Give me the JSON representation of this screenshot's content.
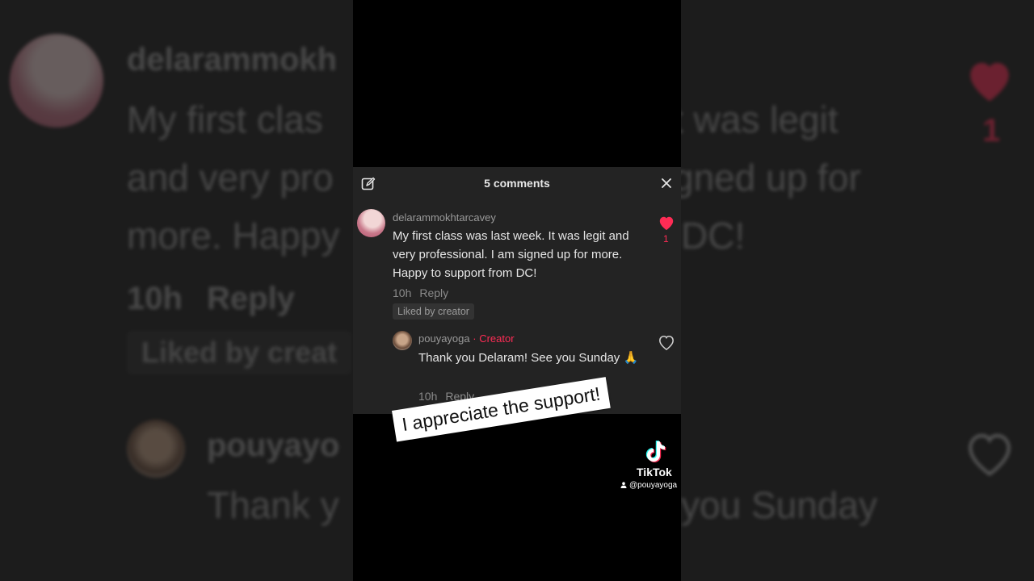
{
  "panel": {
    "title": "5 comments"
  },
  "comment1": {
    "username": "delarammokhtarcavey",
    "text": "My first class was last week. It was legit and very professional. I am signed up for more. Happy to support from DC!",
    "time": "10h",
    "reply_label": "Reply",
    "liked_chip": "Liked by creator",
    "like_count": "1",
    "liked": true
  },
  "reply1": {
    "username": "pouyayoga",
    "separator": "·",
    "creator_label": "Creator",
    "text": "Thank you Delaram! See you Sunday 🙏",
    "time": "10h",
    "reply_label": "Reply",
    "liked": false
  },
  "overlay": {
    "caption": "I appreciate the support!"
  },
  "watermark": {
    "brand": "TikTok",
    "handle": "@pouyayoga"
  },
  "background": {
    "left_name": "delarammokh",
    "left_line1": "My first clas",
    "left_line2": "and very pro",
    "left_line3": "more. Happy",
    "left_meta_time": "10h",
    "left_meta_reply": "Reply",
    "left_chip": "Liked by creat",
    "left_name2": "pouyayo",
    "left_line4": "Thank y",
    "right_line1": "t was legit",
    "right_line2": "gned up for",
    "right_line3": "DC!",
    "right_count": "1",
    "right_line4": "you Sunday"
  },
  "colors": {
    "accent": "#fe2c55",
    "panel_bg": "#232323",
    "caption_bg": "#ffffff"
  },
  "icons": [
    "edit-icon",
    "close-icon",
    "heart-icon",
    "heart-outline-icon",
    "tiktok-logo-icon",
    "user-icon"
  ]
}
